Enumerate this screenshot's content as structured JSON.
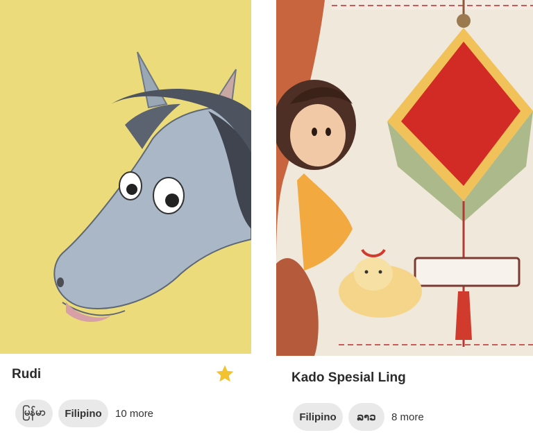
{
  "cards": [
    {
      "title": "Rudi",
      "favorite": true,
      "star_icon": "star-icon",
      "star_color": "#f2c230",
      "cover_color": "#ecdb7a",
      "languages": [
        "မြန်မာ",
        "Filipino"
      ],
      "more": "10 more"
    },
    {
      "title": "Kado Spesial Ling",
      "favorite": false,
      "cover_color": "#f1e8dc",
      "languages": [
        "Filipino",
        "ລາວ"
      ],
      "more": "8 more"
    }
  ]
}
